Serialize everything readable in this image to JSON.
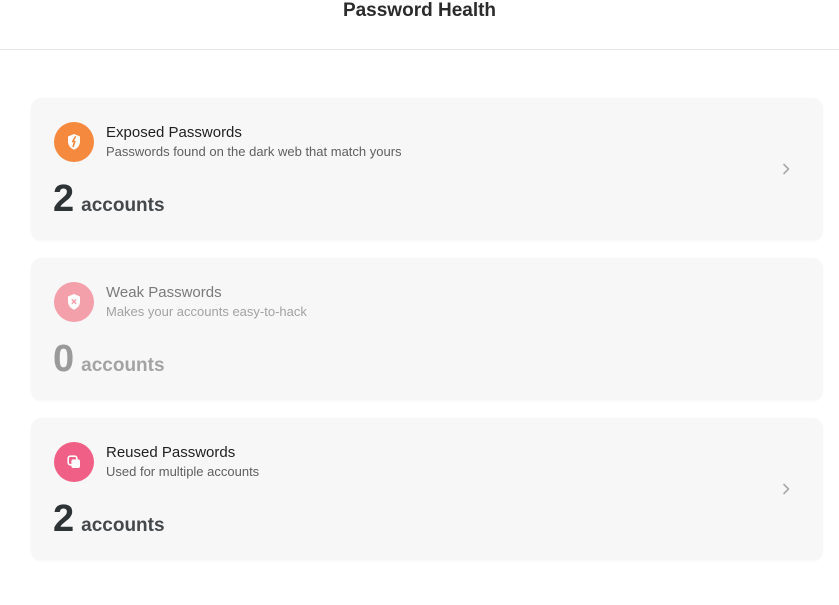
{
  "header": {
    "title": "Password Health"
  },
  "cards": [
    {
      "title": "Exposed Passwords",
      "subtitle": "Passwords found on the dark web that match yours",
      "count": "2",
      "unit": "accounts",
      "icon": "broken-shield-icon",
      "icon_color": "#f5893e",
      "has_chevron": true
    },
    {
      "title": "Weak Passwords",
      "subtitle": "Makes your accounts easy-to-hack",
      "count": "0",
      "unit": "accounts",
      "icon": "shield-x-icon",
      "icon_color": "#f3a0ab",
      "has_chevron": false
    },
    {
      "title": "Reused Passwords",
      "subtitle": "Used for multiple accounts",
      "count": "2",
      "unit": "accounts",
      "icon": "copy-icon",
      "icon_color": "#f05f86",
      "has_chevron": true
    }
  ],
  "colors": {
    "card_bg": "#f7f7f7",
    "chevron": "#a8a8a8"
  }
}
